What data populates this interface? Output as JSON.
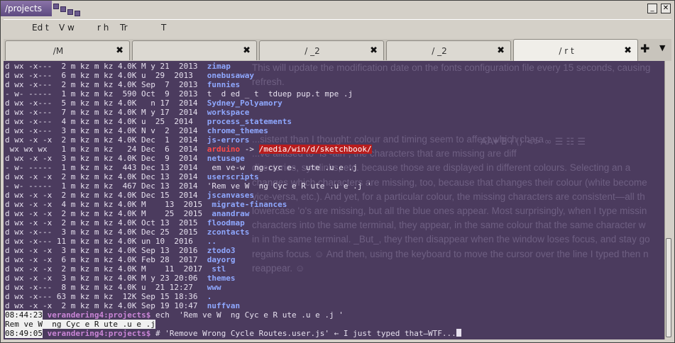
{
  "window": {
    "title": "/projects",
    "minimize_label": "_",
    "close_label": "✕"
  },
  "menu": [
    "Edit",
    "View",
    "Search",
    "Terminal",
    "Tabs",
    "Help"
  ],
  "menu_visible": [
    "Ed t",
    "V w",
    "r h",
    "Tr",
    "T"
  ],
  "tabs": [
    {
      "label": "/M"
    },
    {
      "label": ""
    },
    {
      "label": "/ _2"
    },
    {
      "label": "/ _2"
    },
    {
      "label": "/ r t"
    }
  ],
  "tab_close": "✖",
  "tab_add": "✚",
  "tab_menu": "▼",
  "listing": [
    {
      "perms": "d wx -x---",
      "links": "2",
      "user": "m kz",
      "group": "m kz",
      "size": "4.0K",
      "date": "M y 21  2013",
      "name": "zimap",
      "type": "dir"
    },
    {
      "perms": "d wx -x---",
      "links": "6",
      "user": "m kz",
      "group": "m kz",
      "size": "4.0K",
      "date": "u  29  2013",
      "name": "onebusaway",
      "type": "dir"
    },
    {
      "perms": "d wx -x---",
      "links": "2",
      "user": "m kz",
      "group": "m kz",
      "size": "4.0K",
      "date": "Sep  7  2013",
      "name": "funnies",
      "type": "dir"
    },
    {
      "perms": "- w- -----",
      "links": "1",
      "user": "m kz",
      "group": "m kz",
      "size": " 590",
      "date": "Oct  9  2013",
      "name": "t  d ed _ t  tduep pup.t mpe .j",
      "type": "file"
    },
    {
      "perms": "d wx -x---",
      "links": "5",
      "user": "m kz",
      "group": "m kz",
      "size": "4.0K",
      "date": "  n 17  2014",
      "name": "Sydney_Polyamory",
      "type": "dir"
    },
    {
      "perms": "d wx -x---",
      "links": "7",
      "user": "m kz",
      "group": "m kz",
      "size": "4.0K",
      "date": "M y 17  2014",
      "name": "workspace",
      "type": "dir"
    },
    {
      "perms": "d wx -x---",
      "links": "4",
      "user": "m kz",
      "group": "m kz",
      "size": "4.0K",
      "date": "u  25  2014",
      "name": "process_statements",
      "type": "dir"
    },
    {
      "perms": "d wx -x---",
      "links": "3",
      "user": "m kz",
      "group": "m kz",
      "size": "4.0K",
      "date": "N v  2  2014",
      "name": "chrome_themes",
      "type": "dir"
    },
    {
      "perms": "d wx -x -x",
      "links": "2",
      "user": "m kz",
      "group": "m kz",
      "size": "4.0K",
      "date": "Dec  1  2014",
      "name": "js-errors",
      "type": "dir"
    },
    {
      "perms": " wx wx wx",
      "links": "1",
      "user": "m kz",
      "group": "m kz",
      "size": "  24",
      "date": "Dec  6  2014",
      "name": "arduino",
      "type": "link",
      "target": "/media/win/d/sketchbook/"
    },
    {
      "perms": "d wx -x -x",
      "links": "3",
      "user": "m kz",
      "group": "m kz",
      "size": "4.0K",
      "date": "Dec  9  2014",
      "name": "netusage",
      "type": "dir"
    },
    {
      "perms": "- w- -----",
      "links": "1",
      "user": "m kz",
      "group": "m kz",
      "size": " 443",
      "date": "Dec 13  2014",
      "name": " em ve-w  ng-cyc e-  ute .u e .j",
      "type": "file"
    },
    {
      "perms": "d wx -x -x",
      "links": "2",
      "user": "m kz",
      "group": "m kz",
      "size": "4.0K",
      "date": "Dec 13  2014",
      "name": "userscripts",
      "type": "dir"
    },
    {
      "perms": "- w- -----",
      "links": "1",
      "user": "m kz",
      "group": "m kz",
      "size": " 467",
      "date": "Dec 13  2014",
      "name": "'Rem ve W  ng Cyc e R ute .u e .j '",
      "type": "file"
    },
    {
      "perms": "d wx -x -x",
      "links": "2",
      "user": "m kz",
      "group": "m kz",
      "size": "4.0K",
      "date": "Dec 15  2014",
      "name": "jscanvases",
      "type": "dir"
    },
    {
      "perms": "d wx -x -x",
      "links": "4",
      "user": "m kz",
      "group": "m kz",
      "size": "4.0K",
      "date": "M    13  2015",
      "name": "migrate-finances",
      "type": "dir"
    },
    {
      "perms": "d wx -x -x",
      "links": "2",
      "user": "m kz",
      "group": "m kz",
      "size": "4.0K",
      "date": "M    25  2015",
      "name": "anandraw",
      "type": "dir"
    },
    {
      "perms": "d wx -x -x",
      "links": "2",
      "user": "m kz",
      "group": "m kz",
      "size": "4.0K",
      "date": "Oct 13  2015",
      "name": "floodmap",
      "type": "dir"
    },
    {
      "perms": "d wx -x---",
      "links": "3",
      "user": "m kz",
      "group": "m kz",
      "size": "4.0K",
      "date": "Dec 25  2015",
      "name": "zcontacts",
      "type": "dir"
    },
    {
      "perms": "d wx -x---",
      "links": "11",
      "user": "m kz",
      "group": "m kz",
      "size": "4.0K",
      "date": "un 10  2016",
      "name": "..",
      "type": "dir"
    },
    {
      "perms": "d wx -x -x",
      "links": "3",
      "user": "m kz",
      "group": "m kz",
      "size": "4.0K",
      "date": "Sep 13  2016",
      "name": "ztodo3",
      "type": "dir"
    },
    {
      "perms": "d wx -x -x",
      "links": "6",
      "user": "m kz",
      "group": "m kz",
      "size": "4.0K",
      "date": "Feb 28  2017",
      "name": "dayorg",
      "type": "dir"
    },
    {
      "perms": "d wx -x -x",
      "links": "2",
      "user": "m kz",
      "group": "m kz",
      "size": "4.0K",
      "date": "M    11  2017",
      "name": "stl",
      "type": "dir"
    },
    {
      "perms": "d wx -x -x",
      "links": "3",
      "user": "m kz",
      "group": "m kz",
      "size": "4.0K",
      "date": "M y 23 20:06",
      "name": "themes",
      "type": "dir"
    },
    {
      "perms": "d wx -x---",
      "links": "8",
      "user": "m kz",
      "group": "m kz",
      "size": "4.0K",
      "date": "u  21 12:27",
      "name": "www",
      "type": "dir"
    },
    {
      "perms": "d wx -x---",
      "links": "63",
      "user": "m kz",
      "group": "m kz",
      "size": " 12K",
      "date": "Sep 15 18:36",
      "name": ".",
      "type": "dir"
    },
    {
      "perms": "d wx -x -x",
      "links": "2",
      "user": "m kz",
      "group": "m kz",
      "size": "4.0K",
      "date": "Sep 19 10:47",
      "name": "nuffvan",
      "type": "dir"
    }
  ],
  "session": [
    {
      "time": "08:44:23",
      "user": "verandering4",
      "cwd": "projects",
      "command": "ech  'Rem ve W  ng Cyc e R ute .u e .j '"
    },
    {
      "output": "Rem ve W  ng Cyc e R ute .u e .j"
    },
    {
      "time": "08:49:05",
      "user": "verandering4",
      "cwd": "projects",
      "command": "# 'Remove Wrong Cycle Routes.user.js' ← I just typed that—WTF..."
    }
  ],
  "background_text": [
    "This will update the modification date on the fonts configuration file every 15 seconds, causing",
    "refresh.",
    "",
    "",
    "",
    "   ...sistent than I thought: colour and timing seem to affect which chara",
    "   ...ve aliased to `ls -alh`, the characters that are missing are diff",
    "directories, symlinks, etc. because those are displayed in different colours. Selecting an a",
    "changes which characters are missing, too, because that changes their colour (white become",
    "vice-versa, etc.). And yet, for a particular colour, the missing characters are consistent—all th",
    "lowercase 'o's are missing, but all the blue ones appear. Most surprisingly, when I type missin",
    "characters into the same terminal, they appear, in the same colour that the same character w",
    "in in the same terminal. _But_, they then disappear when the window loses focus, and stay go",
    "regains focus. ☺ And then, using the keyboard to move the cursor over the line I typed then n",
    "reappear. ☺"
  ],
  "background_toolbar": "AA▾  B  i       ⟨⟩  <>  ∞        ☰  ☷  ☰"
}
